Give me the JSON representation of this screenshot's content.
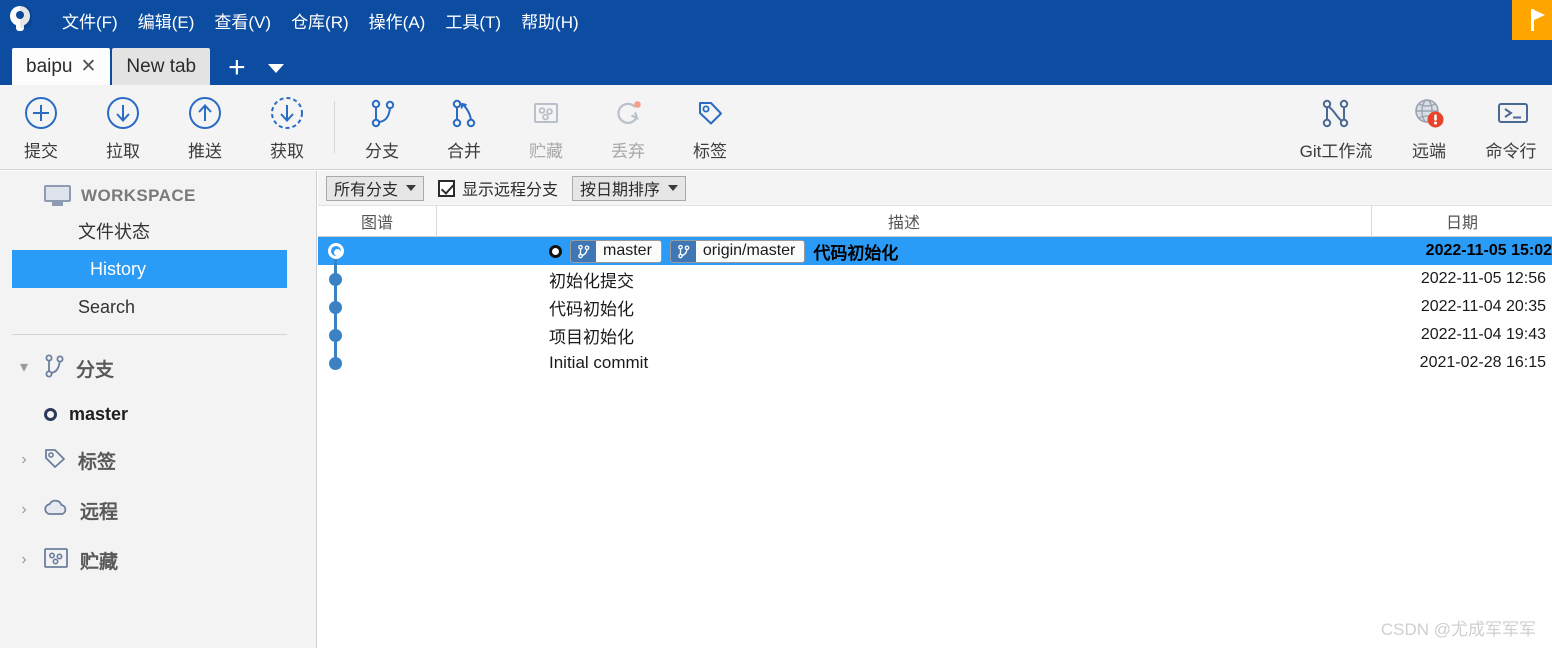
{
  "app": {
    "logo_icon": "sourcetree-logo-icon",
    "flag_button_icon": "flag-icon"
  },
  "menubar": {
    "items": [
      {
        "label": "文件(F)",
        "name": "menu-file"
      },
      {
        "label": "编辑(E)",
        "name": "menu-edit"
      },
      {
        "label": "查看(V)",
        "name": "menu-view"
      },
      {
        "label": "仓库(R)",
        "name": "menu-repository"
      },
      {
        "label": "操作(A)",
        "name": "menu-actions"
      },
      {
        "label": "工具(T)",
        "name": "menu-tools"
      },
      {
        "label": "帮助(H)",
        "name": "menu-help"
      }
    ]
  },
  "tabs": {
    "items": [
      {
        "label": "baipu",
        "active": true,
        "close_icon": "close-icon"
      },
      {
        "label": "New tab",
        "active": false
      }
    ],
    "add_label": "+",
    "add_icon": "plus-icon",
    "dropdown_icon": "chevron-down-icon"
  },
  "toolbar": {
    "buttons": [
      {
        "label": "提交",
        "icon": "commit-plus-circle-icon",
        "disabled": false
      },
      {
        "label": "拉取",
        "icon": "pull-arrow-down-circle-icon",
        "disabled": false
      },
      {
        "label": "推送",
        "icon": "push-arrow-up-circle-icon",
        "disabled": false
      },
      {
        "label": "获取",
        "icon": "fetch-dashed-circle-icon",
        "disabled": false
      },
      {
        "label": "分支",
        "icon": "branch-icon",
        "disabled": false
      },
      {
        "label": "合并",
        "icon": "merge-icon",
        "disabled": false
      },
      {
        "label": "贮藏",
        "icon": "stash-icon",
        "disabled": true
      },
      {
        "label": "丢弃",
        "icon": "discard-icon",
        "disabled": true
      },
      {
        "label": "标签",
        "icon": "tag-icon",
        "disabled": false
      }
    ],
    "right_buttons": [
      {
        "label": "Git工作流",
        "icon": "gitflow-icon",
        "disabled": false
      },
      {
        "label": "远端",
        "icon": "remote-globe-icon",
        "badge": "!",
        "disabled": false
      },
      {
        "label": "命令行",
        "icon": "terminal-icon",
        "disabled": false
      }
    ]
  },
  "sidebar": {
    "workspace_title": "WORKSPACE",
    "workspace_icon": "monitor-icon",
    "items": [
      {
        "label": "文件状态",
        "name": "sidebar-item-file-status",
        "selected": false
      },
      {
        "label": "History",
        "name": "sidebar-item-history",
        "selected": true
      },
      {
        "label": "Search",
        "name": "sidebar-item-search",
        "selected": false
      }
    ],
    "groups": [
      {
        "label": "分支",
        "icon": "branch-icon",
        "expanded": true,
        "chevron": "chevron-down-icon"
      },
      {
        "label": "标签",
        "icon": "tag-icon",
        "expanded": false,
        "chevron": "chevron-right-icon"
      },
      {
        "label": "远程",
        "icon": "cloud-icon",
        "expanded": false,
        "chevron": "chevron-right-icon"
      },
      {
        "label": "贮藏",
        "icon": "stash-icon",
        "expanded": false,
        "chevron": "chevron-right-icon"
      }
    ],
    "branches": [
      {
        "label": "master",
        "icon": "branch-dot-icon"
      }
    ]
  },
  "filterbar": {
    "branch_filter": {
      "label": "所有分支",
      "icon": "chevron-down-icon"
    },
    "show_remote": {
      "label": "显示远程分支",
      "checked": true
    },
    "sort": {
      "label": "按日期排序",
      "icon": "chevron-down-icon"
    }
  },
  "columns": {
    "graph": "图谱",
    "description": "描述",
    "date": "日期"
  },
  "commits": [
    {
      "message": "代码初始化",
      "date": "2022-11-05 15:02",
      "selected": true,
      "head_dot": true,
      "refs": [
        {
          "name": "master",
          "icon": "branch-icon"
        },
        {
          "name": "origin/master",
          "icon": "branch-icon"
        }
      ]
    },
    {
      "message": "初始化提交",
      "date": "2022-11-05 12:56",
      "selected": false,
      "refs": []
    },
    {
      "message": "代码初始化",
      "date": "2022-11-04 20:35",
      "selected": false,
      "refs": []
    },
    {
      "message": "项目初始化",
      "date": "2022-11-04 19:43",
      "selected": false,
      "refs": []
    },
    {
      "message": "Initial commit",
      "date": "2021-02-28 16:15",
      "selected": false,
      "refs": []
    }
  ],
  "watermark": "CSDN @尤成军军军",
  "colors": {
    "titlebar": "#0c4da2",
    "accent_selection": "#2a9bf7",
    "flag_button": "#ffa500",
    "graph_node": "#3b82c4",
    "toolbar_bg": "#f4f4f4",
    "sidebar_bg": "#f3f3f3",
    "badge_red": "#e8442b"
  }
}
